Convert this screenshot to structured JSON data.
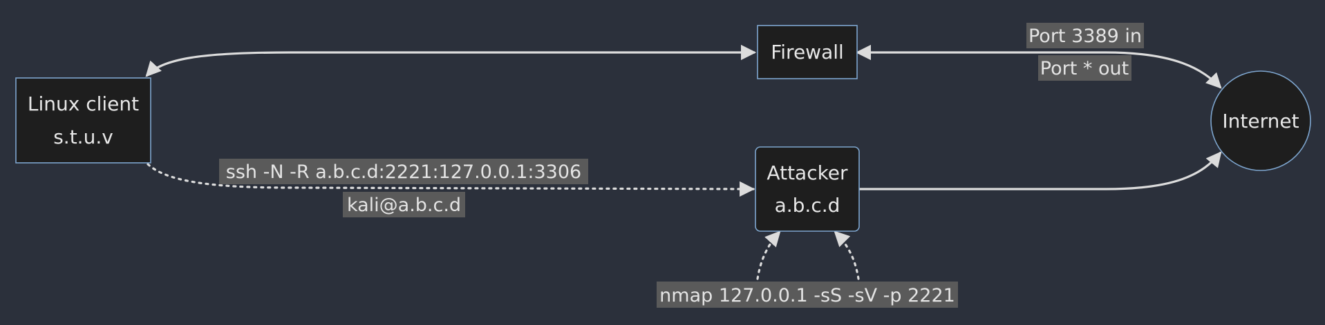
{
  "diagram": {
    "nodes": {
      "linux_client": {
        "line1": "Linux client",
        "line2": "s.t.u.v"
      },
      "firewall": {
        "label": "Firewall"
      },
      "attacker": {
        "line1": "Attacker",
        "line2": "a.b.c.d"
      },
      "internet": {
        "label": "Internet"
      }
    },
    "edge_labels": {
      "port_in": "Port 3389 in",
      "port_out": "Port * out",
      "ssh_cmd": "ssh -N -R a.b.c.d:2221:127.0.0.1:3306",
      "ssh_user": "kali@a.b.c.d",
      "nmap_cmd": "nmap 127.0.0.1 -sS -sV -p 2221"
    }
  }
}
